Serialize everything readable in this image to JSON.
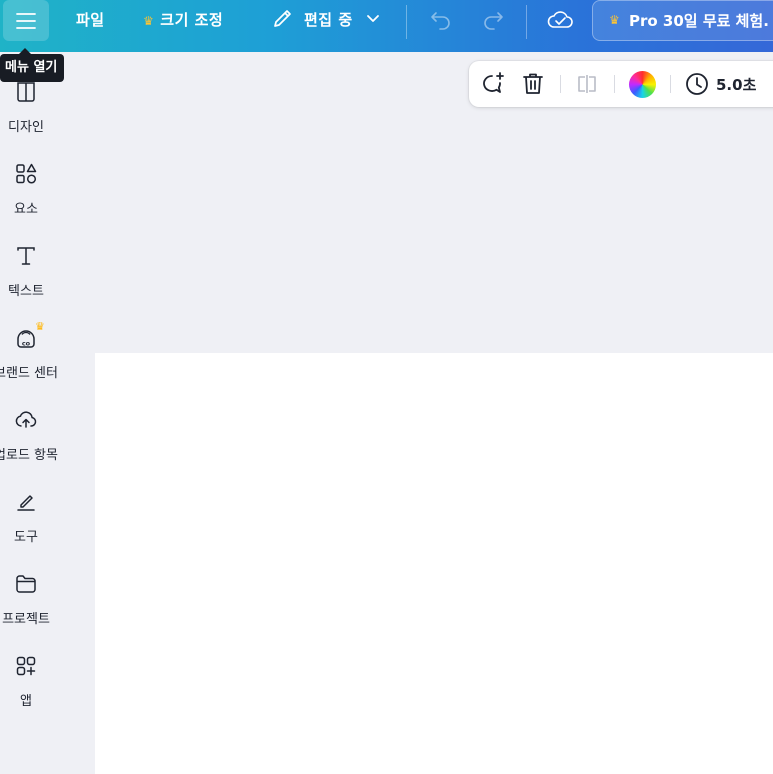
{
  "topbar": {
    "menu_tooltip": "메뉴 열기",
    "file_label": "파일",
    "resize_label": "크기 조정",
    "editing_label": "편집 중",
    "pro_trial_label": "Pro 30일 무료 체험."
  },
  "sidebar": {
    "items": [
      {
        "label": "디자인",
        "icon": "layout-icon"
      },
      {
        "label": "요소",
        "icon": "shapes-icon"
      },
      {
        "label": "텍스트",
        "icon": "text-icon"
      },
      {
        "label": "브랜드 센터",
        "icon": "brand-icon",
        "pro": true
      },
      {
        "label": "업로드 항목",
        "icon": "upload-cloud-icon"
      },
      {
        "label": "도구",
        "icon": "pen-tool-icon"
      },
      {
        "label": "프로젝트",
        "icon": "folder-icon"
      },
      {
        "label": "앱",
        "icon": "apps-icon"
      }
    ]
  },
  "context_toolbar": {
    "duration": "5.0초"
  },
  "colors": {
    "accent_crown": "#ffc531",
    "topbar_start": "#1fb3c7",
    "topbar_end": "#3568d8",
    "canvas_bg": "#eff0f5",
    "page_bg": "#ffffff"
  }
}
